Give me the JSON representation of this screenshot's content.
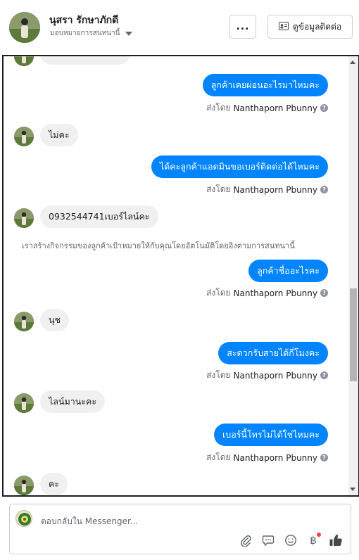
{
  "header": {
    "name": "นุสรา รักษาภักดี",
    "assign_label": "มอบหมายการสนทนานี้",
    "more_label": "...",
    "contact_label": "ดูข้อมูลติดต่อ"
  },
  "messages": [
    {
      "type": "out",
      "text": "ลูกค้าเคยผ่อนอะไรมาไหมคะ",
      "sent_by_prefix": "ส่งโดย",
      "sent_by_name": "Nanthaporn Pbunny"
    },
    {
      "type": "in",
      "text": "ไม่คะ"
    },
    {
      "type": "out",
      "text": "ได้คะลูกค้าแอดมินขอเบอร์ติดต่อได้ไหมคะ",
      "sent_by_prefix": "ส่งโดย",
      "sent_by_name": "Nanthaporn Pbunny"
    },
    {
      "type": "in",
      "text": "0932544741เบอร์ไลน์คะ"
    },
    {
      "type": "notice",
      "text": "เราสร้างกิจกรรมของลูกค้าเป้าหมายให้กับคุณโดยอัตโนมัติโดยอิงตามการสนทนานี้"
    },
    {
      "type": "out",
      "text": "ลูกค้าชื่ออะไรคะ",
      "sent_by_prefix": "ส่งโดย",
      "sent_by_name": "Nanthaporn Pbunny"
    },
    {
      "type": "in",
      "text": "นุช"
    },
    {
      "type": "out",
      "text": "สะดวกรับสายได้กี่โมงคะ",
      "sent_by_prefix": "ส่งโดย",
      "sent_by_name": "Nanthaporn Pbunny"
    },
    {
      "type": "in",
      "text": "ไลน์มานะคะ"
    },
    {
      "type": "out",
      "text": "เบอร์นี้โทรไม่ได้ใช่ไหมคะ",
      "sent_by_prefix": "ส่งโดย",
      "sent_by_name": "Nanthaporn Pbunny"
    },
    {
      "type": "in",
      "text": "คะ"
    }
  ],
  "composer": {
    "placeholder": "ตอบกลับใน Messenger..."
  },
  "icons": {
    "attach": "paperclip-icon",
    "quick_reply": "chat-bubble-icon",
    "emoji": "smiley-icon",
    "payment": "baht-icon",
    "like": "thumbs-up-icon"
  },
  "colors": {
    "outgoing_bubble": "#0084ff",
    "incoming_bubble": "#f0f0f0",
    "notification_dot": "#fa3e3e"
  }
}
